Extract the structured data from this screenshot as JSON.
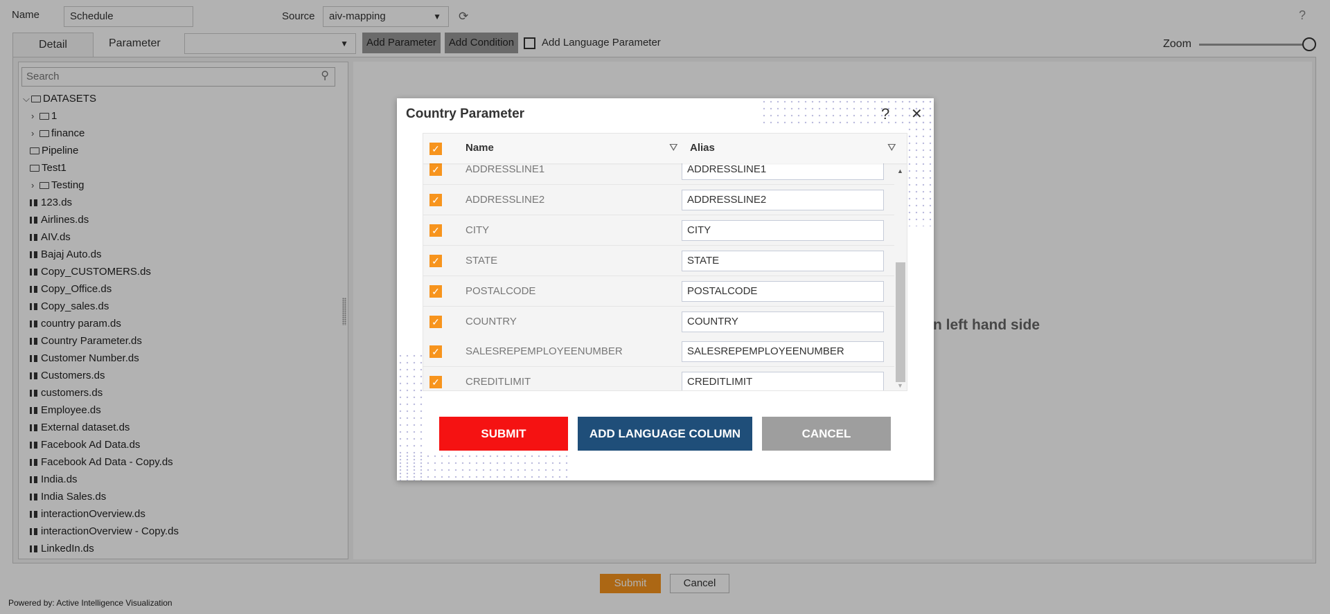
{
  "header": {
    "name_label": "Name",
    "name_value": "Schedule",
    "source_label": "Source",
    "source_value": "aiv-mapping",
    "help": "?"
  },
  "tabs": {
    "detail": "Detail",
    "parameter": "Parameter",
    "param_select": "",
    "add_parameter": "Add Parameter",
    "add_condition": "Add Condition",
    "add_language_parameter": "Add Language Parameter",
    "zoom_label": "Zoom",
    "zoom_level": 1.0
  },
  "tree": {
    "search_placeholder": "Search",
    "items": [
      {
        "label": "DATASETS",
        "type": "folder",
        "depth": 0,
        "chevron": "open"
      },
      {
        "label": "1",
        "type": "folder",
        "depth": 1,
        "chevron": "closed"
      },
      {
        "label": "finance",
        "type": "folder",
        "depth": 1,
        "chevron": "closed"
      },
      {
        "label": "Pipeline",
        "type": "folder",
        "depth": 1
      },
      {
        "label": "Test1",
        "type": "folder",
        "depth": 1
      },
      {
        "label": "Testing",
        "type": "folder",
        "depth": 1,
        "chevron": "closed"
      },
      {
        "label": "123.ds",
        "type": "dataset",
        "depth": 1
      },
      {
        "label": "Airlines.ds",
        "type": "dataset",
        "depth": 1
      },
      {
        "label": "AIV.ds",
        "type": "dataset",
        "depth": 1
      },
      {
        "label": "Bajaj Auto.ds",
        "type": "dataset",
        "depth": 1
      },
      {
        "label": "Copy_CUSTOMERS.ds",
        "type": "dataset",
        "depth": 1
      },
      {
        "label": "Copy_Office.ds",
        "type": "dataset",
        "depth": 1
      },
      {
        "label": "Copy_sales.ds",
        "type": "dataset",
        "depth": 1
      },
      {
        "label": "country param.ds",
        "type": "dataset",
        "depth": 1
      },
      {
        "label": "Country Parameter.ds",
        "type": "dataset",
        "depth": 1
      },
      {
        "label": "Customer Number.ds",
        "type": "dataset",
        "depth": 1
      },
      {
        "label": "Customers.ds",
        "type": "dataset",
        "depth": 1
      },
      {
        "label": "customers.ds",
        "type": "dataset",
        "depth": 1
      },
      {
        "label": "Employee.ds",
        "type": "dataset",
        "depth": 1
      },
      {
        "label": "External dataset.ds",
        "type": "dataset",
        "depth": 1
      },
      {
        "label": "Facebook Ad Data.ds",
        "type": "dataset",
        "depth": 1
      },
      {
        "label": "Facebook Ad Data - Copy.ds",
        "type": "dataset",
        "depth": 1
      },
      {
        "label": "India.ds",
        "type": "dataset",
        "depth": 1
      },
      {
        "label": "India Sales.ds",
        "type": "dataset",
        "depth": 1
      },
      {
        "label": "interactionOverview.ds",
        "type": "dataset",
        "depth": 1
      },
      {
        "label": "interactionOverview - Copy.ds",
        "type": "dataset",
        "depth": 1
      },
      {
        "label": "LinkedIn.ds",
        "type": "dataset",
        "depth": 1
      }
    ]
  },
  "main": {
    "hint": "n left hand side"
  },
  "dialog": {
    "title": "Country Parameter",
    "help": "?",
    "close": "✕",
    "columns": {
      "name": "Name",
      "alias": "Alias"
    },
    "rows": [
      {
        "name": "ADDRESSLINE1",
        "alias": "ADDRESSLINE1",
        "checked": true
      },
      {
        "name": "ADDRESSLINE2",
        "alias": "ADDRESSLINE2",
        "checked": true
      },
      {
        "name": "CITY",
        "alias": "CITY",
        "checked": true
      },
      {
        "name": "STATE",
        "alias": "STATE",
        "checked": true
      },
      {
        "name": "POSTALCODE",
        "alias": "POSTALCODE",
        "checked": true
      },
      {
        "name": "COUNTRY",
        "alias": "COUNTRY",
        "checked": true
      },
      {
        "name": "SALESREPEMPLOYEENUMBER",
        "alias": "SALESREPEMPLOYEENUMBER",
        "checked": true
      },
      {
        "name": "CREDITLIMIT",
        "alias": "CREDITLIMIT",
        "checked": true
      }
    ],
    "submit": "SUBMIT",
    "add_language_column": "ADD LANGUAGE COLUMN",
    "cancel": "CANCEL",
    "colors": {
      "submit": "#f51212",
      "add_language": "#1f4e79",
      "cancel": "#9e9e9e",
      "checkbox": "#f7941d"
    }
  },
  "footer": {
    "submit": "Submit",
    "cancel": "Cancel",
    "powered_by": "Powered by: Active Intelligence Visualization"
  }
}
